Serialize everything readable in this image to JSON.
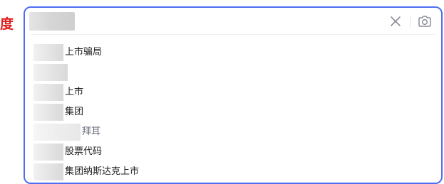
{
  "logo": {
    "fragment": "度"
  },
  "search": {
    "value": "",
    "placeholder": ""
  },
  "icons": {
    "clear": "close-icon",
    "camera": "camera-icon"
  },
  "colors": {
    "accent": "#4e6ef2",
    "logo": "#e02020"
  },
  "suggestions": [
    {
      "text": "上市骗局"
    },
    {
      "text": ""
    },
    {
      "text": "上市"
    },
    {
      "text": "集团"
    },
    {
      "text": "拜耳"
    },
    {
      "text": "股票代码"
    },
    {
      "text": "集团纳斯达克上市"
    }
  ]
}
